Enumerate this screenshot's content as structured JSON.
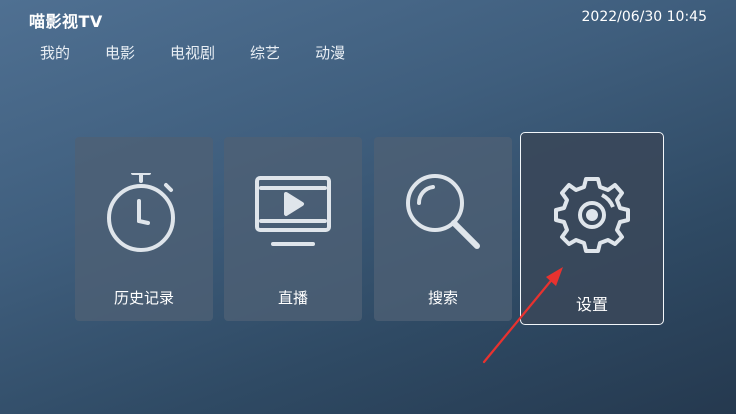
{
  "header": {
    "app_title": "喵影视TV",
    "datetime": "2022/06/30 10:45"
  },
  "nav": {
    "tabs": [
      {
        "label": "我的"
      },
      {
        "label": "电影"
      },
      {
        "label": "电视剧"
      },
      {
        "label": "综艺"
      },
      {
        "label": "动漫"
      }
    ]
  },
  "tiles": [
    {
      "label": "历史记录",
      "icon": "stopwatch-icon"
    },
    {
      "label": "直播",
      "icon": "tv-play-icon"
    },
    {
      "label": "搜索",
      "icon": "search-icon"
    },
    {
      "label": "设置",
      "icon": "gear-icon",
      "focused": true
    }
  ],
  "annotation": {
    "type": "arrow",
    "color": "#e8322f",
    "points_to": "设置"
  },
  "colors": {
    "background_start": "#4f7092",
    "background_end": "#25394f",
    "tile_background": "#4e6074",
    "focus_border": "#f2f6fa"
  }
}
